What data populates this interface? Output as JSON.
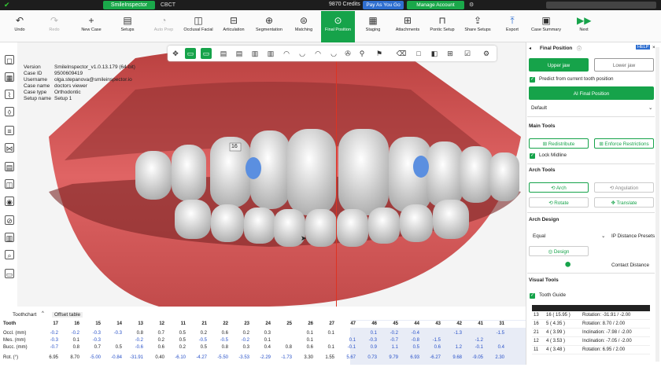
{
  "topbar": {
    "tabs": [
      "SmileInspector",
      "CBCT"
    ],
    "credits": "9870 Credits",
    "pay_as_you_go": "Pay As You Go",
    "manage_account": "Manage Account"
  },
  "toolbar": {
    "undo": "Undo",
    "redo": "Redo",
    "new_case": "New Case",
    "setups": "Setups",
    "auto_prep": "Auto Prep",
    "occlusal_facial": "Occlusal Facial",
    "articulation": "Articulation",
    "segmentation": "Segmentation",
    "matching": "Matching",
    "final_position": "Final Position",
    "staging": "Staging",
    "attachments": "Attachments",
    "pontic_setup": "Pontic Setup",
    "share_setups": "Share Setups",
    "export": "Export",
    "case_summary": "Case Summary",
    "next": "Next"
  },
  "info": {
    "rows": [
      {
        "k": "Version",
        "v": "SmileInspector_v1.0.13.179 (64-bit)"
      },
      {
        "k": "Case ID",
        "v": "9500609419"
      },
      {
        "k": "Username",
        "v": "olga.stepanova@smileinspector.io"
      },
      {
        "k": "Case name",
        "v": "doctors viewer"
      },
      {
        "k": "Case type",
        "v": "Orthodontic"
      },
      {
        "k": "Setup name",
        "v": "Setup 1"
      }
    ]
  },
  "viewport": {
    "tooth_label": "16"
  },
  "panel": {
    "title": "Final Position",
    "help": "HELP",
    "upper_jaw": "Upper jaw",
    "lower_jaw": "Lower jaw",
    "predict": "Predict from current tooth position",
    "ai_final": "AI Final Position",
    "default": "Default",
    "main_tools": "Main Tools",
    "redistribute": "Redistribute",
    "enforce": "Enforce Restrictions",
    "lock_midline": "Lock Midline",
    "arch_tools": "Arch Tools",
    "arch": "Arch",
    "angulation": "Angulation",
    "rotate": "Rotate",
    "translate": "Translate",
    "arch_design": "Arch Design",
    "equal": "Equal",
    "ip_distance": "IP Distance Presets",
    "design": "Design",
    "contact_distance": "Contact Distance",
    "visual_tools": "Visual Tools",
    "tooth_guide": "Tooth Guide",
    "guide_rows": [
      {
        "n": "13",
        "t": "16 ( 15.95 )",
        "d": "Rotation: -31.91 / -2.00"
      },
      {
        "n": "16",
        "t": "5 ( 4.35 )",
        "d": "Rotation: 8.70 / 2.00"
      },
      {
        "n": "21",
        "t": "4 ( 3.99 )",
        "d": "Inclination: -7.98 / -2.00"
      },
      {
        "n": "12",
        "t": "4 ( 3.53 )",
        "d": "Inclination: -7.05 / -2.00"
      },
      {
        "n": "11",
        "t": "4 ( 3.48 )",
        "d": "Rotation: 6.95 / 2.00"
      }
    ]
  },
  "bottom": {
    "tab1": "Toothchart",
    "tab2": "Offset table",
    "header": "Tooth",
    "teeth": [
      "17",
      "16",
      "15",
      "14",
      "13",
      "12",
      "11",
      "21",
      "22",
      "23",
      "24",
      "25",
      "26",
      "27",
      "47",
      "46",
      "45",
      "44",
      "43",
      "42",
      "41",
      "31"
    ],
    "rows": [
      {
        "label": "Occl. (mm)",
        "vals": [
          "-0.2",
          "-0.2",
          "-0.3",
          "-0.3",
          "0.8",
          "0.7",
          "0.5",
          "0.2",
          "0.6",
          "0.2",
          "0.3",
          "",
          "0.1",
          "0.1",
          "",
          "0.1",
          "-0.2",
          "-0.4",
          "",
          "-1.3",
          "",
          "-1.5"
        ]
      },
      {
        "label": "Mes. (mm)",
        "vals": [
          "-0.3",
          "0.1",
          "-0.3",
          "",
          "-0.2",
          "0.2",
          "0.5",
          "-0.5",
          "-0.5",
          "-0.2",
          "0.1",
          "",
          "0.1",
          "",
          "0.1",
          "-0.3",
          "-0.7",
          "-0.8",
          "-1.5",
          "",
          "-1.2",
          ""
        ]
      },
      {
        "label": "Bucc. (mm)",
        "vals": [
          "-0.7",
          "0.8",
          "0.7",
          "0.5",
          "-0.6",
          "0.6",
          "0.2",
          "0.5",
          "0.8",
          "0.3",
          "0.4",
          "0.8",
          "0.6",
          "0.1",
          "-0.1",
          "0.9",
          "1.1",
          "0.5",
          "0.6",
          "1.2",
          "-0.1",
          "0.4"
        ]
      },
      {
        "label": "Rot. (°)",
        "vals": [
          "6.95",
          "8.70",
          "-5.00",
          "-0.84",
          "-31.91",
          "0.40",
          "-6.10",
          "-4.27",
          "-5.50",
          "-3.53",
          "-2.29",
          "-1.73",
          "3.30",
          "1.55",
          "5.67",
          "0.73",
          "9.79",
          "6.93",
          "-6.27",
          "9.68",
          "-9.05",
          "2.30"
        ]
      }
    ]
  }
}
